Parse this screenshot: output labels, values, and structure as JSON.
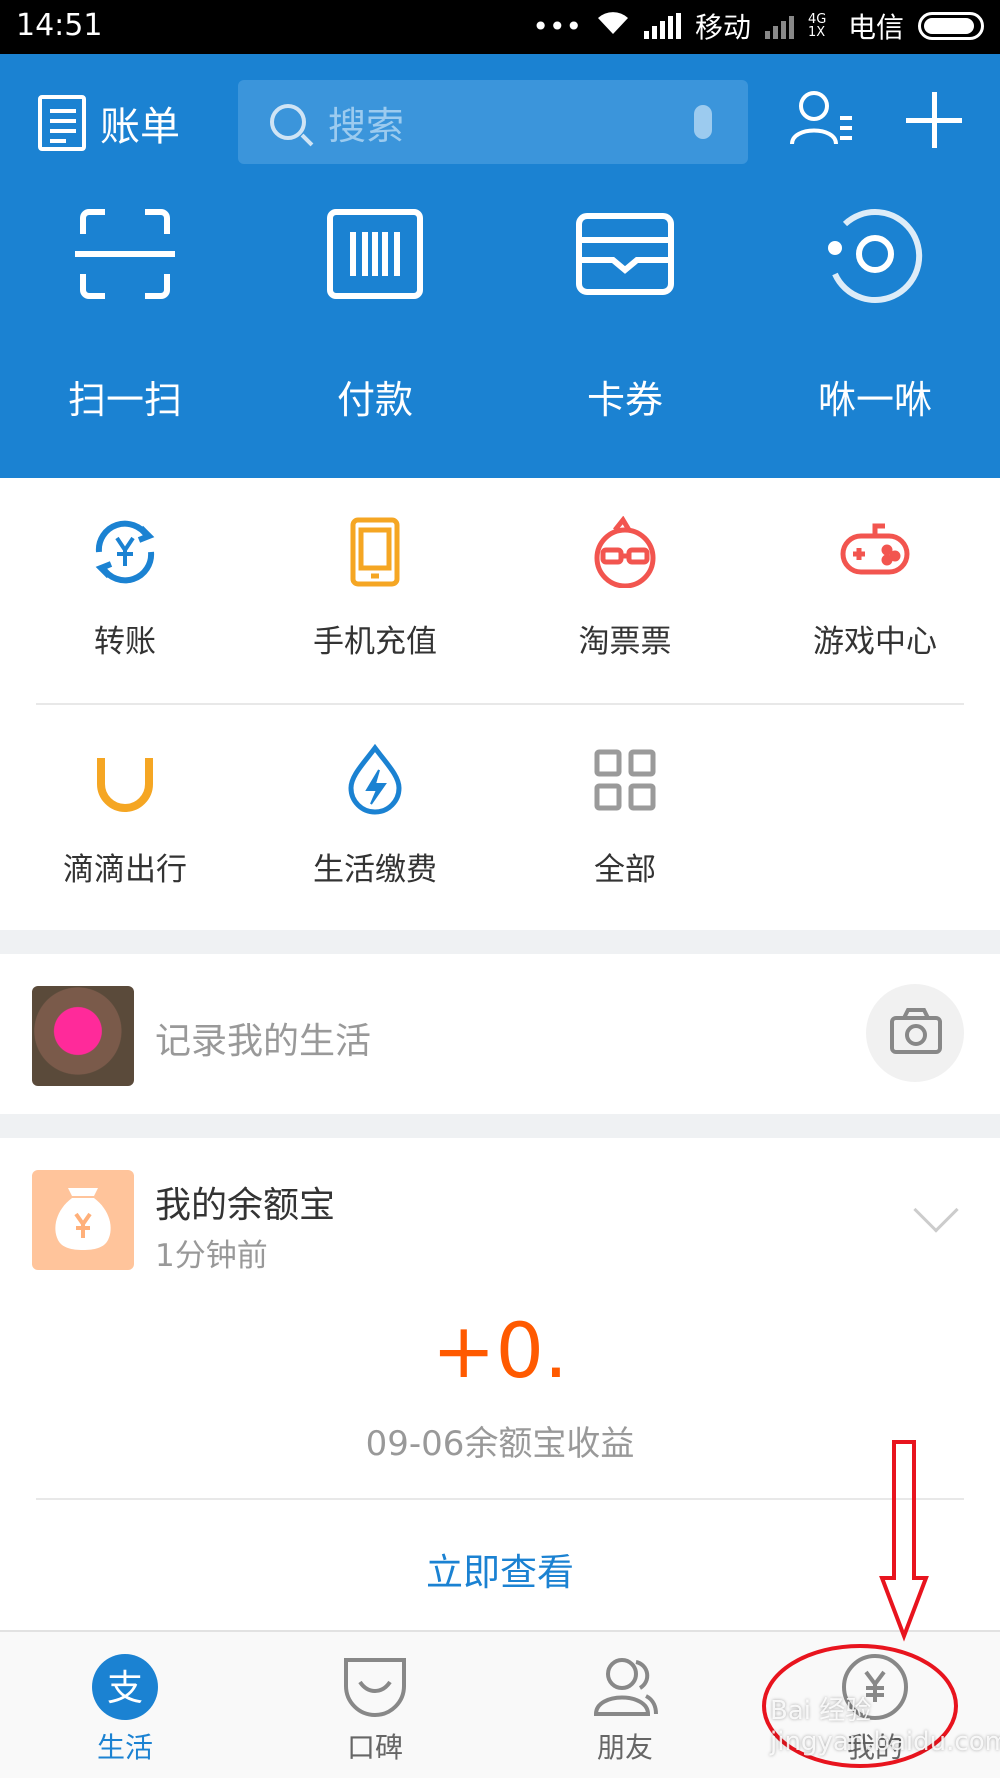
{
  "status_bar": {
    "time": "14:51",
    "carrier1": "移动",
    "carrier2": "电信",
    "net": "4G 1X"
  },
  "header": {
    "bill_label": "账单",
    "search_placeholder": "搜索"
  },
  "quick_actions": [
    {
      "label": "扫一扫",
      "icon": "scan-icon"
    },
    {
      "label": "付款",
      "icon": "barcode-icon"
    },
    {
      "label": "卡券",
      "icon": "card-wallet-icon"
    },
    {
      "label": "咻一咻",
      "icon": "xiu-icon"
    }
  ],
  "services_row1": [
    {
      "label": "转账",
      "icon": "transfer-icon",
      "color": "#1b82d2"
    },
    {
      "label": "手机充值",
      "icon": "phone-recharge-icon",
      "color": "#f5a623"
    },
    {
      "label": "淘票票",
      "icon": "taopiaopiao-icon",
      "color": "#f2554f"
    },
    {
      "label": "游戏中心",
      "icon": "game-controller-icon",
      "color": "#f2554f"
    }
  ],
  "services_row2": [
    {
      "label": "滴滴出行",
      "icon": "didi-icon",
      "color": "#f5a623"
    },
    {
      "label": "生活缴费",
      "icon": "utility-bill-icon",
      "color": "#1b82d2"
    },
    {
      "label": "全部",
      "icon": "grid-all-icon",
      "color": "#999999"
    }
  ],
  "record": {
    "placeholder": "记录我的生活"
  },
  "yuebao": {
    "title": "我的余额宝",
    "time": "1分钟前",
    "amount": "+0.",
    "caption": "09-06余额宝收益",
    "action": "立即查看"
  },
  "tabs": [
    {
      "label": "生活",
      "icon": "alipay-life-icon",
      "active": true
    },
    {
      "label": "口碑",
      "icon": "koubei-icon",
      "active": false
    },
    {
      "label": "朋友",
      "icon": "friends-icon",
      "active": false
    },
    {
      "label": "我的",
      "icon": "my-wallet-icon",
      "active": false
    }
  ],
  "watermark": "Bai 经验 jingyan.baidu.com",
  "colors": {
    "primary": "#1b82d2",
    "amount": "#ff5a00",
    "annotation": "#e8141e"
  }
}
